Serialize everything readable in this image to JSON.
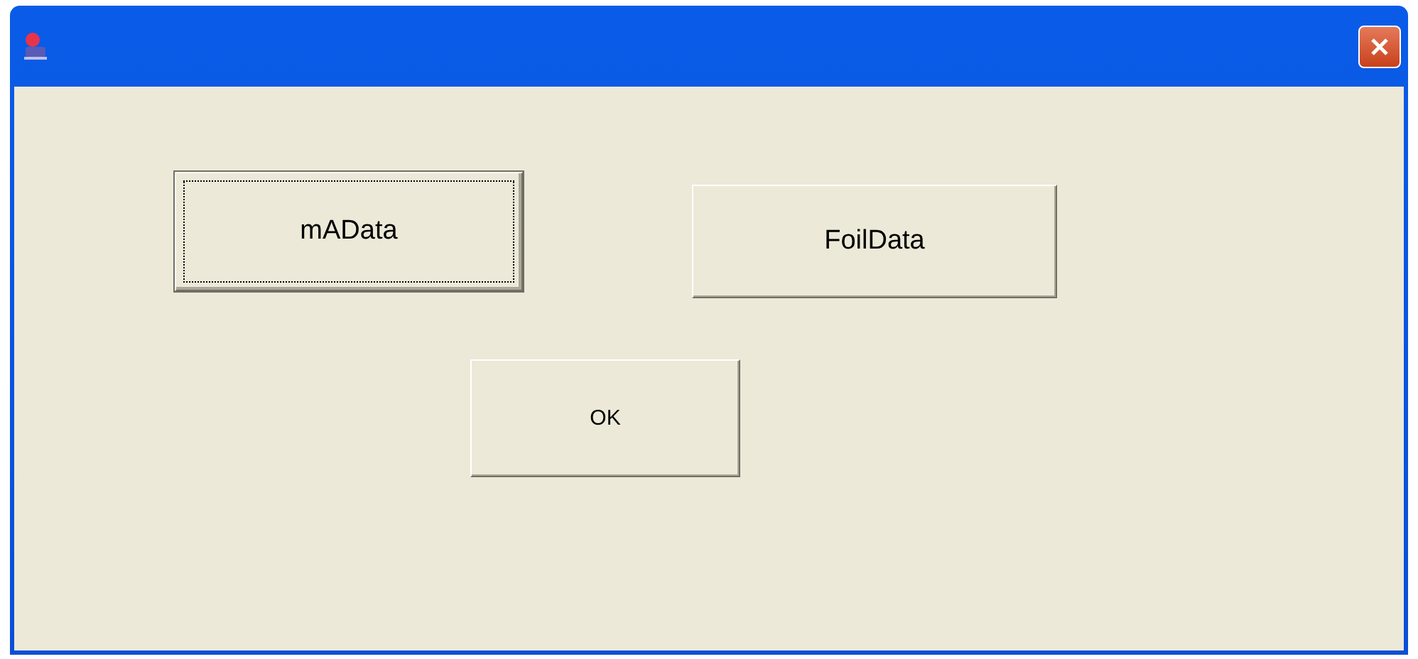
{
  "buttons": [
    {
      "label": "mAData",
      "focused": true
    },
    {
      "label": "FoilData",
      "focused": false
    },
    {
      "label": "OK",
      "focused": false
    }
  ]
}
